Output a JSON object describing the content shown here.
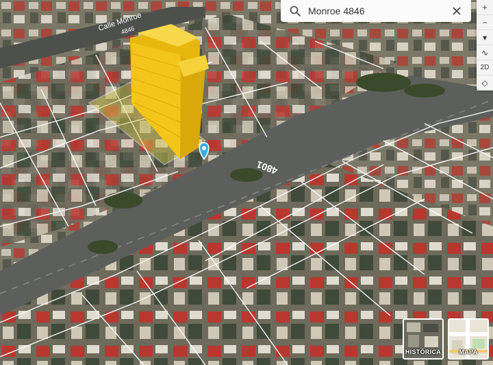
{
  "search": {
    "query": "Monroe 4846"
  },
  "street": {
    "label_top": "Calle Monroe",
    "label_number_top": "4846",
    "label_number_main": "4801"
  },
  "controls": {
    "zoom_in": "+",
    "zoom_out": "−",
    "north": "▾",
    "tilt": "∿",
    "view_2d": "2D",
    "measure": "◇"
  },
  "layers": {
    "historica": "HISTÓRICA",
    "mapa": "MAPA"
  },
  "colors": {
    "building_highlight": "#f3c51a",
    "marker": "#3aaee3",
    "parcel_lines": "#ffffff"
  },
  "icons": {
    "search": "search-icon",
    "close": "close-icon",
    "marker": "location-marker-icon"
  }
}
